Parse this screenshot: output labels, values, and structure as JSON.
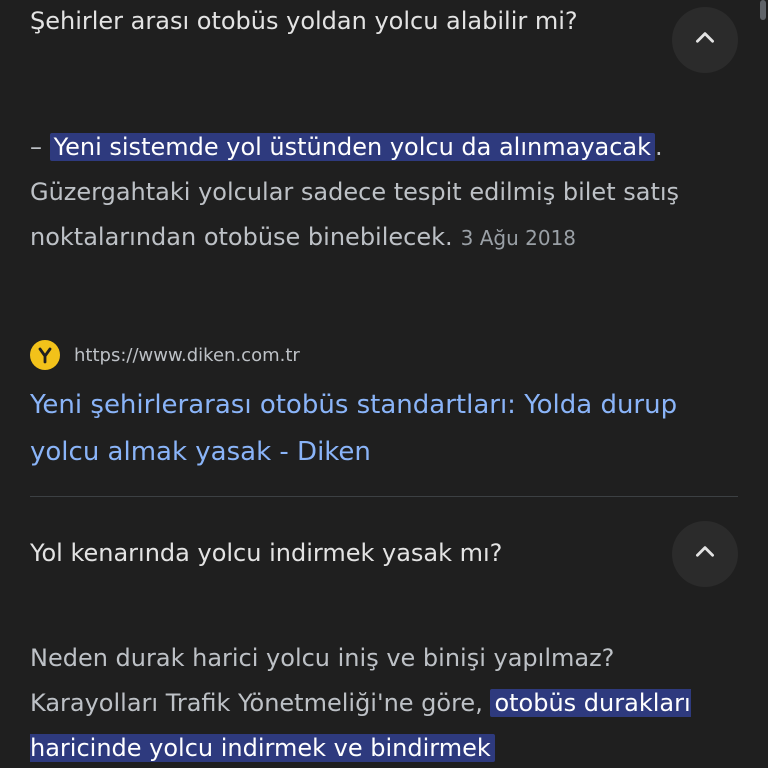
{
  "faq1": {
    "question": "Şehirler arası otobüs yoldan yolcu alabilir mi?",
    "answer_prefix": "– ",
    "answer_highlight": "Yeni sistemde yol üstünden yolcu da alınmayacak",
    "answer_rest": ". Güzergahtaki yolcular sadece tespit edilmiş bilet satış noktalarından otobüse binebilecek.",
    "date": "3 Ağu 2018",
    "source_url": "https://www.diken.com.tr",
    "result_title": "Yeni şehirlerarası otobüs standartları: Yolda durup yolcu almak yasak - Diken",
    "collapse_icon": "chevron-up-icon",
    "favicon_icon": "diken-logo-icon"
  },
  "faq2": {
    "question": "Yol kenarında yolcu indirmek yasak mı?",
    "answer_text": "Neden durak harici yolcu iniş ve binişi yapılmaz? Karayolları Trafik Yönetmeliği'ne göre, ",
    "answer_highlight": "otobüs durakları haricinde yolcu indirmek ve bindirmek",
    "collapse_icon": "chevron-up-icon"
  },
  "colors": {
    "background": "#1f1f1f",
    "highlight": "#2e3a7e",
    "link": "#8ab4f8",
    "favicon": "#f2c21a"
  }
}
